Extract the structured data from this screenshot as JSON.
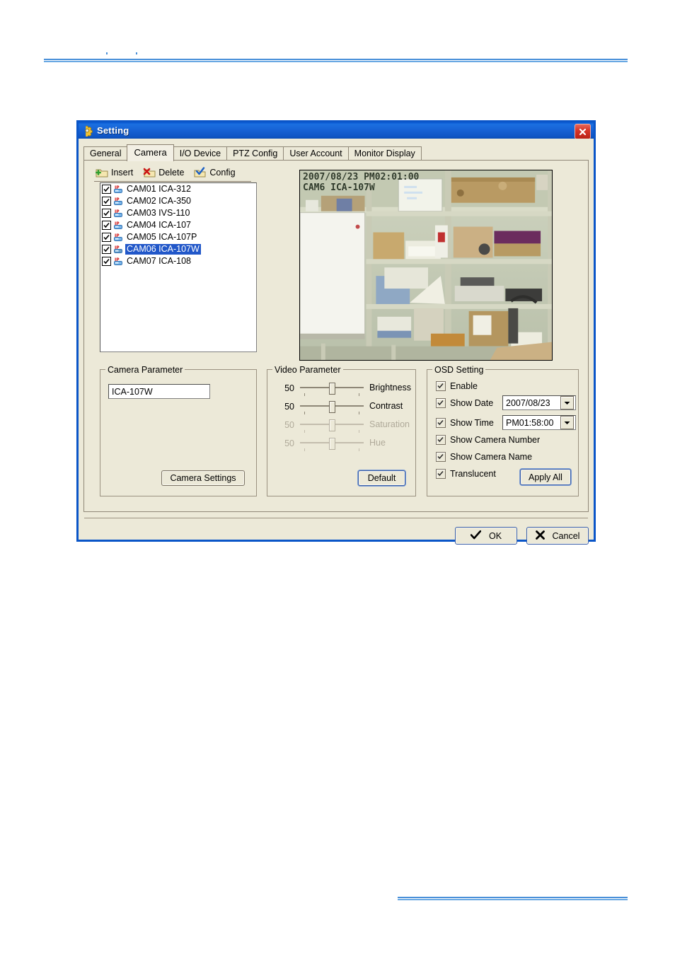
{
  "dialog": {
    "title": "Setting",
    "title_icon": "gear-icon",
    "close_icon": "close-icon"
  },
  "tabs": [
    {
      "label": "General",
      "active": false
    },
    {
      "label": "Camera",
      "active": true
    },
    {
      "label": "I/O Device",
      "active": false
    },
    {
      "label": "PTZ Config",
      "active": false
    },
    {
      "label": "User Account",
      "active": false
    },
    {
      "label": "Monitor Display",
      "active": false
    }
  ],
  "toolbar": {
    "insert_label": "Insert",
    "delete_label": "Delete",
    "config_label": "Config"
  },
  "camera_list": [
    {
      "label": "CAM01 ICA-312",
      "checked": true,
      "selected": false
    },
    {
      "label": "CAM02 ICA-350",
      "checked": true,
      "selected": false
    },
    {
      "label": "CAM03 IVS-110",
      "checked": true,
      "selected": false
    },
    {
      "label": "CAM04 ICA-107",
      "checked": true,
      "selected": false
    },
    {
      "label": "CAM05 ICA-107P",
      "checked": true,
      "selected": false
    },
    {
      "label": "CAM06 ICA-107W",
      "checked": true,
      "selected": true
    },
    {
      "label": "CAM07 ICA-108",
      "checked": true,
      "selected": false
    }
  ],
  "preview": {
    "osd_line1": "2007/08/23 PM02:01:00",
    "osd_line2": "CAM6 ICA-107W"
  },
  "camera_parameter": {
    "legend": "Camera Parameter",
    "name_value": "ICA-107W",
    "settings_button": "Camera Settings"
  },
  "video_parameter": {
    "legend": "Video Parameter",
    "default_button": "Default",
    "sliders": [
      {
        "label": "Brightness",
        "value": "50",
        "enabled": true
      },
      {
        "label": "Contrast",
        "value": "50",
        "enabled": true
      },
      {
        "label": "Saturation",
        "value": "50",
        "enabled": false
      },
      {
        "label": "Hue",
        "value": "50",
        "enabled": false
      }
    ]
  },
  "osd_setting": {
    "legend": "OSD Setting",
    "apply_all_button": "Apply All",
    "rows": [
      {
        "label": "Enable",
        "checked": true
      },
      {
        "label": "Show Date",
        "checked": true
      },
      {
        "label": "Show Time",
        "checked": true
      },
      {
        "label": "Show Camera Number",
        "checked": true
      },
      {
        "label": "Show Camera Name",
        "checked": true
      },
      {
        "label": "Translucent",
        "checked": true
      }
    ],
    "date_value": "2007/08/23",
    "time_value": "PM01:58:00"
  },
  "footer": {
    "ok_label": "OK",
    "cancel_label": "Cancel"
  },
  "colors": {
    "titlebar_blue": "#0a5ad4",
    "dialog_face": "#ece9d8",
    "selection_blue": "#2157c9",
    "rule_blue": "#4a90d9",
    "close_red": "#d8372a"
  }
}
